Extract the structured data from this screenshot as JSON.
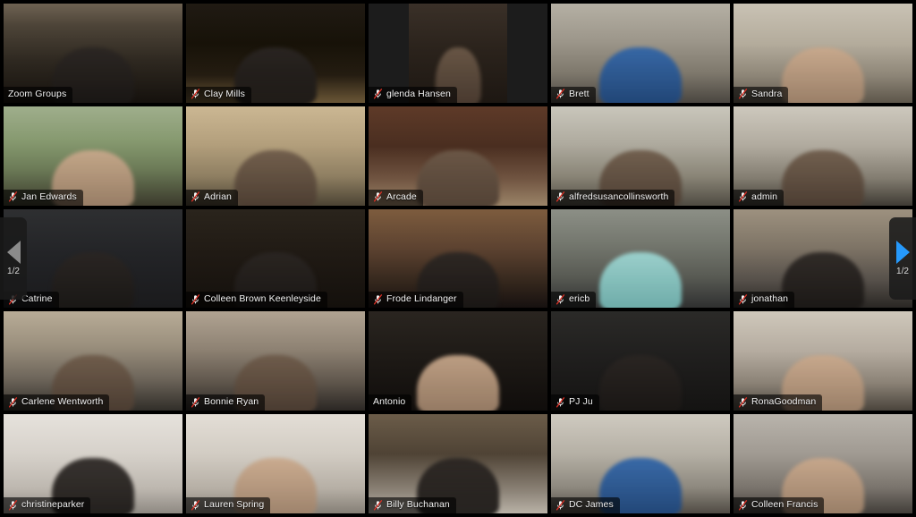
{
  "app": {
    "name": "Zoom",
    "view": "Gallery View",
    "grid_columns": 5,
    "grid_rows": 5,
    "active_speaker_border_color": "#b9dc3c",
    "nameplate_background": "rgba(0,0,0,0.62)",
    "background_color": "#000000"
  },
  "pagination": {
    "prev": {
      "icon": "chevron-left-icon",
      "label": "1/2",
      "enabled": false,
      "color": "#8b8b8b"
    },
    "next": {
      "icon": "chevron-right-icon",
      "label": "1/2",
      "enabled": true,
      "color": "#2699fb"
    }
  },
  "icons": {
    "muted": "microphone-muted-icon"
  },
  "participants": [
    {
      "name": "Zoom Groups",
      "muted": false,
      "active_speaker": true,
      "bg": "linear-gradient(180deg,#6e6252 0%,#4d4438 22%,#2e2820 58%,#15110d 100%)",
      "pillar": false,
      "fig": "dark"
    },
    {
      "name": "Clay Mills",
      "muted": true,
      "active_speaker": false,
      "bg": "linear-gradient(180deg,#201a13 0%,#171208 40%,#241c11 72%,#6a5636 100%)",
      "pillar": false,
      "fig": "dark"
    },
    {
      "name": "glenda Hansen",
      "muted": true,
      "active_speaker": false,
      "bg": "linear-gradient(180deg,#3a3028 0%,#2b231c 45%,#1d1712 100%)",
      "pillar": true,
      "fig": "mid"
    },
    {
      "name": "Brett",
      "muted": true,
      "active_speaker": false,
      "bg": "linear-gradient(180deg,#b5b0a4 0%,#9c968a 38%,#7e786c 70%,#4a4640 100%)",
      "pillar": false,
      "fig": "blue"
    },
    {
      "name": "Sandra",
      "muted": true,
      "active_speaker": false,
      "bg": "linear-gradient(180deg,#c9c2b4 0%,#b4ac9c 40%,#8e8678 72%,#5d564a 100%)",
      "pillar": false,
      "fig": "light"
    },
    {
      "name": "Jan Edwards",
      "muted": true,
      "active_speaker": false,
      "bg": "linear-gradient(180deg,#9fae8c 0%,#86996f 35%,#6d7c58 62%,#3b3a2c 100%)",
      "pillar": false,
      "fig": "light"
    },
    {
      "name": "Adrian",
      "muted": true,
      "active_speaker": false,
      "bg": "linear-gradient(180deg,#cbb793 0%,#b39f7c 38%,#8f7f62 70%,#4c4434 100%)",
      "pillar": false,
      "fig": "mid"
    },
    {
      "name": "Arcade",
      "muted": true,
      "active_speaker": false,
      "bg": "linear-gradient(180deg,#5e3a28 0%,#4a2e20 40%,#6f5340 72%,#9b8468 100%)",
      "pillar": false,
      "fig": "mid"
    },
    {
      "name": "alfredsusancollinsworth",
      "muted": true,
      "active_speaker": false,
      "bg": "linear-gradient(180deg,#c9c6bb 0%,#aeaa9e 38%,#8a8577 70%,#4f4b42 100%)",
      "pillar": false,
      "fig": "mid"
    },
    {
      "name": "admin",
      "muted": true,
      "active_speaker": false,
      "bg": "linear-gradient(180deg,#cdc8bd 0%,#b0aa9e 40%,#837d71 72%,#3f3b34 100%)",
      "pillar": false,
      "fig": "mid"
    },
    {
      "name": "Catrine",
      "muted": true,
      "active_speaker": false,
      "bg": "linear-gradient(180deg,#2e2f31 0%,#232427 45%,#1a1a1c 100%)",
      "pillar": false,
      "fig": "dark"
    },
    {
      "name": "Colleen Brown Keenleyside",
      "muted": true,
      "active_speaker": false,
      "bg": "linear-gradient(180deg,#2a241c 0%,#201a14 45%,#14100c 100%)",
      "pillar": false,
      "fig": "dark"
    },
    {
      "name": "Frode Lindanger",
      "muted": true,
      "active_speaker": false,
      "bg": "linear-gradient(180deg,#7d5c3e 0%,#5c4230 40%,#33261c 75%,#171110 100%)",
      "pillar": false,
      "fig": "dark"
    },
    {
      "name": "ericb",
      "muted": true,
      "active_speaker": false,
      "bg": "linear-gradient(180deg,#8c8f86 0%,#74776e 35%,#595b54 68%,#2f3030 100%)",
      "pillar": false,
      "fig": "teal"
    },
    {
      "name": "jonathan",
      "muted": true,
      "active_speaker": false,
      "bg": "linear-gradient(180deg,#9d917f 0%,#7d7365 40%,#56504a 72%,#2a2724 100%)",
      "pillar": false,
      "fig": "dark"
    },
    {
      "name": "Carlene Wentworth",
      "muted": true,
      "active_speaker": false,
      "bg": "linear-gradient(180deg,#b8ac97 0%,#9a8f7d 35%,#6d655a 68%,#312e29 100%)",
      "pillar": false,
      "fig": "mid"
    },
    {
      "name": "Bonnie Ryan",
      "muted": true,
      "active_speaker": false,
      "bg": "linear-gradient(180deg,#b0a392 0%,#8e8273 38%,#5e554b 72%,#2b2724 100%)",
      "pillar": false,
      "fig": "mid"
    },
    {
      "name": "Antonio",
      "muted": false,
      "active_speaker": false,
      "bg": "linear-gradient(180deg,#2a2520 0%,#1e1a16 45%,#100d0b 100%)",
      "pillar": false,
      "fig": "light"
    },
    {
      "name": "PJ Ju",
      "muted": true,
      "active_speaker": false,
      "bg": "linear-gradient(180deg,#2b2a28 0%,#201f1e 45%,#141312 100%)",
      "pillar": false,
      "fig": "dark"
    },
    {
      "name": "RonaGoodman",
      "muted": true,
      "active_speaker": false,
      "bg": "linear-gradient(180deg,#cfc8bb 0%,#b5aca0 40%,#8b8276 72%,#4a443c 100%)",
      "pillar": false,
      "fig": "light"
    },
    {
      "name": "christineparker",
      "muted": true,
      "active_speaker": false,
      "bg": "linear-gradient(180deg,#e6e2dc 0%,#d6d1ca 40%,#bdb7af 75%,#8e8982 100%)",
      "pillar": false,
      "fig": "dark"
    },
    {
      "name": "Lauren Spring",
      "muted": true,
      "active_speaker": false,
      "bg": "linear-gradient(180deg,#e3ded6 0%,#d2ccc3 40%,#b6afa5 75%,#857f76 100%)",
      "pillar": false,
      "fig": "light"
    },
    {
      "name": "Billy Buchanan",
      "muted": true,
      "active_speaker": false,
      "bg": "linear-gradient(180deg,#6b5c49 0%,#4f4335 40%,#8d8478 78%,#b9b2a7 100%)",
      "pillar": false,
      "fig": "dark"
    },
    {
      "name": "DC James",
      "muted": true,
      "active_speaker": false,
      "bg": "linear-gradient(180deg,#cfcac0 0%,#b5b0a5 40%,#8d887e 74%,#504b44 100%)",
      "pillar": false,
      "fig": "blue"
    },
    {
      "name": "Colleen Francis",
      "muted": true,
      "active_speaker": false,
      "bg": "linear-gradient(180deg,#b9b4ac 0%,#a09a92 40%,#7a746d 74%,#423e39 100%)",
      "pillar": false,
      "fig": "light"
    }
  ]
}
